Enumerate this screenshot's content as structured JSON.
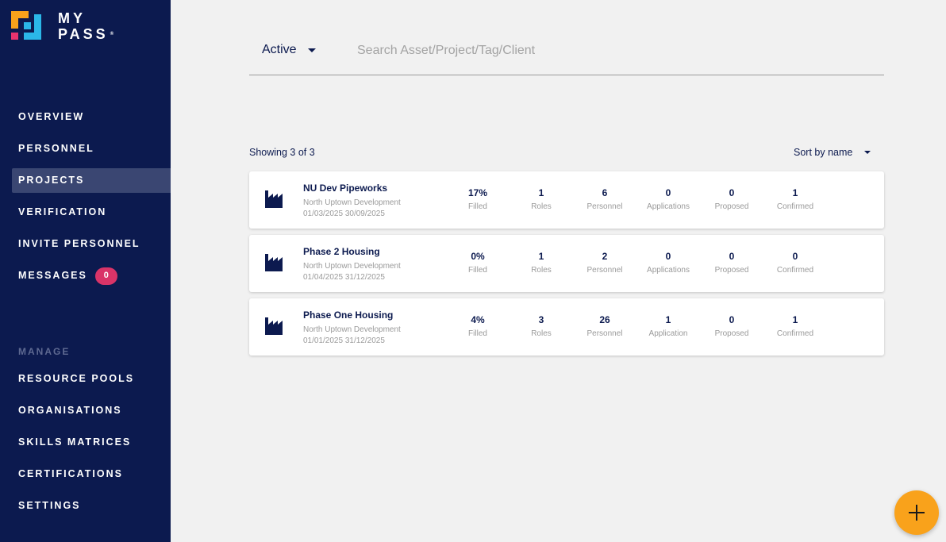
{
  "brand": {
    "line1": "MY",
    "line2": "PASS",
    "tm": "®"
  },
  "nav": [
    {
      "label": "OVERVIEW"
    },
    {
      "label": "PERSONNEL"
    },
    {
      "label": "PROJECTS"
    },
    {
      "label": "VERIFICATION"
    },
    {
      "label": "INVITE PERSONNEL"
    },
    {
      "label": "MESSAGES",
      "badge": "0"
    }
  ],
  "manage": {
    "label": "MANAGE",
    "items": [
      {
        "label": "RESOURCE POOLS"
      },
      {
        "label": "ORGANISATIONS"
      },
      {
        "label": "SKILLS MATRICES"
      },
      {
        "label": "CERTIFICATIONS"
      },
      {
        "label": "SETTINGS"
      }
    ]
  },
  "filter": {
    "selected": "Active"
  },
  "search": {
    "placeholder": "Search Asset/Project/Tag/Client",
    "value": ""
  },
  "list": {
    "showing": "Showing 3 of 3",
    "sort": "Sort by name"
  },
  "projects": [
    {
      "name": "NU Dev Pipeworks",
      "client": "North Uptown Development",
      "dates": "01/03/2025 30/09/2025",
      "stats": [
        {
          "value": "17%",
          "label": "Filled"
        },
        {
          "value": "1",
          "label": "Roles"
        },
        {
          "value": "6",
          "label": "Personnel"
        },
        {
          "value": "0",
          "label": "Applications"
        },
        {
          "value": "0",
          "label": "Proposed"
        },
        {
          "value": "1",
          "label": "Confirmed"
        }
      ]
    },
    {
      "name": "Phase 2 Housing",
      "client": "North Uptown Development",
      "dates": "01/04/2025 31/12/2025",
      "stats": [
        {
          "value": "0%",
          "label": "Filled"
        },
        {
          "value": "1",
          "label": "Roles"
        },
        {
          "value": "2",
          "label": "Personnel"
        },
        {
          "value": "0",
          "label": "Applications"
        },
        {
          "value": "0",
          "label": "Proposed"
        },
        {
          "value": "0",
          "label": "Confirmed"
        }
      ]
    },
    {
      "name": "Phase One Housing",
      "client": "North Uptown Development",
      "dates": "01/01/2025 31/12/2025",
      "stats": [
        {
          "value": "4%",
          "label": "Filled"
        },
        {
          "value": "3",
          "label": "Roles"
        },
        {
          "value": "26",
          "label": "Personnel"
        },
        {
          "value": "1",
          "label": "Application"
        },
        {
          "value": "0",
          "label": "Proposed"
        },
        {
          "value": "1",
          "label": "Confirmed"
        }
      ]
    }
  ],
  "colors": {
    "sidebar": "#0c1a4f",
    "active_nav": "#3a4672",
    "badge": "#d93468",
    "fab": "#f9a21b",
    "logo_orange": "#f9a21b",
    "logo_pink": "#e8336e",
    "logo_cyan": "#2bb7e8"
  },
  "icons": {
    "project": "factory-icon",
    "fab": "plus-icon"
  }
}
